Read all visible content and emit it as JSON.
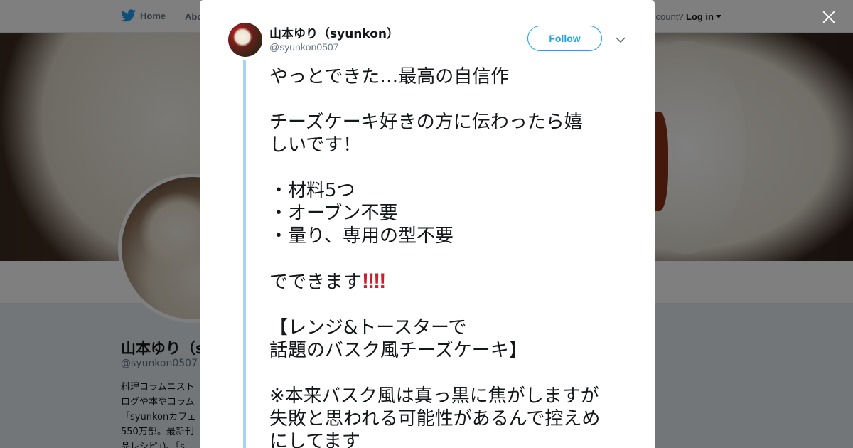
{
  "nav": {
    "home_label": "Home",
    "about_label": "Abo",
    "account_prompt": "ccount?",
    "login_label": "Log in"
  },
  "profile": {
    "name": "山本ゆり（s",
    "handle": "@syunkon0507",
    "bio_lines": [
      "料理コラムニスト",
      "ログや本やコラム",
      "「syunkonカフェ",
      "550万部。最新刊",
      "品レシピ」)、「s"
    ]
  },
  "tweet": {
    "author_name": "山本ゆり（syunkon）",
    "author_handle": "@syunkon0507",
    "follow_label": "Follow",
    "lines": [
      "やっとできた…最高の自信作",
      "",
      "チーズケーキ好きの方に伝わったら嬉",
      "しいです！",
      "",
      "・材料5つ",
      "・オーブン不要",
      "・量り、専用の型不要",
      "",
      "でできます",
      "",
      "【レンジ&トースターで",
      "話題のバスク風チーズケーキ】",
      "",
      "※本来バスク風は真っ黒に焦がしますが",
      "失敗と思われる可能性があるんで控えめ",
      "にしてます"
    ],
    "exclamation_emoji": "‼‼"
  },
  "colors": {
    "accent": "#1da1f2",
    "thread_line": "#a4d4f0",
    "emoji_red": "#c9202c"
  },
  "icons": {
    "nav_home": "twitter-bird-icon",
    "close": "close-icon",
    "more": "chevron-down-icon"
  }
}
